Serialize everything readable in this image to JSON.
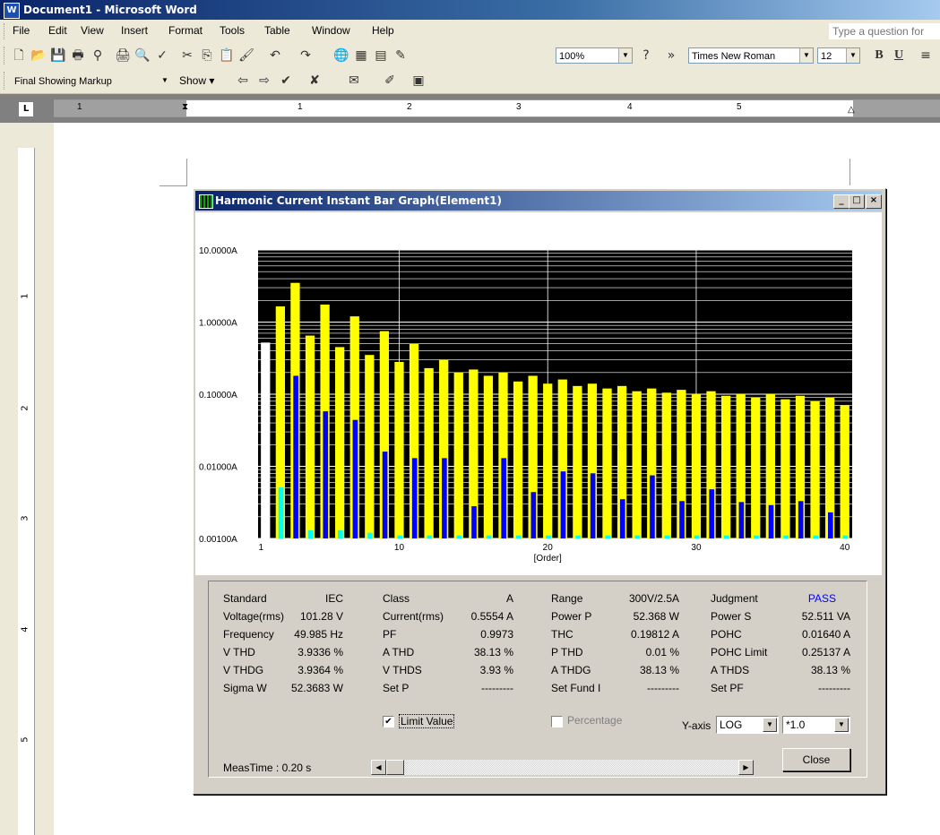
{
  "word": {
    "title": "Document1 - Microsoft Word",
    "menu": [
      "File",
      "Edit",
      "View",
      "Insert",
      "Format",
      "Tools",
      "Table",
      "Window",
      "Help"
    ],
    "help_placeholder": "Type a question for",
    "zoom": "100%",
    "font": "Times New Roman",
    "font_size": "12",
    "bold": "B",
    "underline": "U",
    "markup_view": "Final Showing Markup",
    "show_label": "Show",
    "ruler_numbers": [
      "1",
      "1",
      "2",
      "3",
      "4",
      "5"
    ],
    "vruler_numbers": [
      "1",
      "2",
      "3",
      "4",
      "5"
    ],
    "ruler_tab": "L"
  },
  "dialog": {
    "title": "Harmonic Current Instant Bar Graph(Element1)",
    "minimize": "_",
    "maximize": "□",
    "close_x": "×",
    "info": {
      "rows": [
        [
          [
            "Standard",
            "IEC"
          ],
          [
            "Class",
            "A"
          ],
          [
            "Range",
            "300V/2.5A"
          ],
          [
            "Judgment",
            "PASS"
          ]
        ],
        [
          [
            "Voltage(rms)",
            "101.28 V"
          ],
          [
            "Current(rms)",
            "0.5554 A"
          ],
          [
            "Power P",
            "52.368 W"
          ],
          [
            "Power S",
            "52.511 VA"
          ]
        ],
        [
          [
            "Frequency",
            "49.985 Hz"
          ],
          [
            "PF",
            "0.9973"
          ],
          [
            "THC",
            "0.19812 A"
          ],
          [
            "POHC",
            "0.01640 A"
          ]
        ],
        [
          [
            "V THD",
            "3.9336 %"
          ],
          [
            "A THD",
            "38.13 %"
          ],
          [
            "P THD",
            "0.01 %"
          ],
          [
            "POHC Limit",
            "0.25137 A"
          ]
        ],
        [
          [
            "V THDG",
            "3.9364 %"
          ],
          [
            "V THDS",
            "3.93 %"
          ],
          [
            "A THDG",
            "38.13 %"
          ],
          [
            "A THDS",
            "38.13 %"
          ]
        ],
        [
          [
            "Sigma W",
            "52.3683 W"
          ],
          [
            "Set P",
            "---------"
          ],
          [
            "Set Fund I",
            "---------"
          ],
          [
            "Set PF",
            "---------"
          ]
        ]
      ],
      "limit_value_label": "Limit Value",
      "limit_value_checked": true,
      "percentage_label": "Percentage",
      "percentage_checked": false,
      "yaxis_label": "Y-axis",
      "yaxis_value": "LOG",
      "yscale_value": "*1.0",
      "meas_time": "MeasTime : 0.20 s",
      "close_label": "Close",
      "judgment_color": "#0000ff"
    }
  },
  "chart_data": {
    "type": "bar",
    "yscale": "log",
    "ylim": [
      0.001,
      10
    ],
    "ytick_labels": [
      "10.0000A",
      "1.00000A",
      "0.10000A",
      "0.01000A",
      "0.00100A"
    ],
    "xtick_labels": [
      "1",
      "10",
      "20",
      "30",
      "40"
    ],
    "xlabel": "[Order]",
    "x": [
      1,
      2,
      3,
      4,
      5,
      6,
      7,
      8,
      9,
      10,
      11,
      12,
      13,
      14,
      15,
      16,
      17,
      18,
      19,
      20,
      21,
      22,
      23,
      24,
      25,
      26,
      27,
      28,
      29,
      30,
      31,
      32,
      33,
      34,
      35,
      36,
      37,
      38,
      39,
      40
    ],
    "series": [
      {
        "values": [
          0.52,
          1.65,
          3.5,
          0.65,
          1.75,
          0.45,
          1.2,
          0.35,
          0.75,
          0.28,
          0.5,
          0.23,
          0.3,
          0.2,
          0.22,
          0.18,
          0.2,
          0.15,
          0.18,
          0.14,
          0.16,
          0.13,
          0.14,
          0.12,
          0.13,
          0.11,
          0.12,
          0.105,
          0.115,
          0.1,
          0.11,
          0.095,
          0.1,
          0.09,
          0.1,
          0.085,
          0.095,
          0.08,
          0.09,
          0.07
        ],
        "colors": "limit"
      },
      {
        "values": [
          0.52,
          0.0051,
          0.18,
          0.0013,
          0.058,
          0.0013,
          0.044,
          0.0012,
          0.016,
          0.0011,
          0.013,
          0.0011,
          0.013,
          0.0011,
          0.0028,
          0.0011,
          0.013,
          0.0011,
          0.0044,
          0.0011,
          0.0085,
          0.0011,
          0.008,
          0.0011,
          0.0035,
          0.0011,
          0.0075,
          0.0011,
          0.0033,
          0.0011,
          0.0048,
          0.0011,
          0.0032,
          0.0011,
          0.0029,
          0.0011,
          0.0033,
          0.0011,
          0.0023,
          0.0011
        ],
        "colors": "measured"
      }
    ],
    "colors": {
      "limit": "#ffff00",
      "even": "#00ffff",
      "odd": "#0000ff",
      "fundamental": "#ffffff",
      "background": "#000000",
      "grid": "#ffffff"
    }
  }
}
